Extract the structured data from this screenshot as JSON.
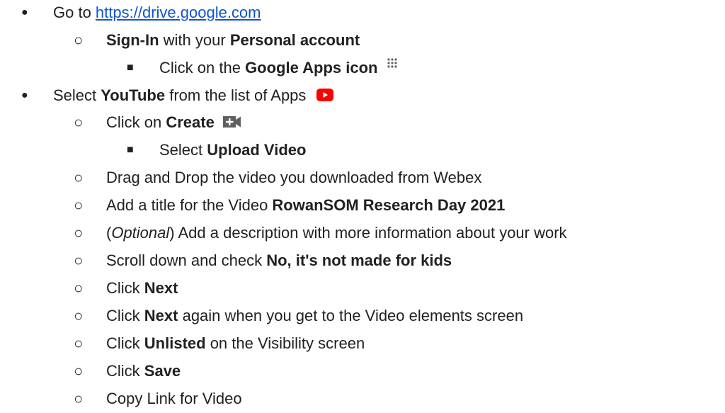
{
  "bullets": {
    "l1": "●",
    "l2": "○",
    "l3": "■"
  },
  "icons": {
    "apps_grid": "google-apps-icon",
    "youtube": "youtube-icon",
    "create": "create-video-icon",
    "youtube_color": "#ff0000"
  },
  "items": [
    {
      "pre": "Go to ",
      "link": "https://drive.google.com"
    },
    {
      "b1": "Sign-In",
      "t1": " with your ",
      "b2": "Personal account"
    },
    {
      "pre": "Click on the ",
      "bold": "Google Apps icon"
    },
    {
      "pre": "Select ",
      "bold": "YouTube",
      "post": " from the list of Apps"
    },
    {
      "pre": "Click on ",
      "bold": "Create"
    },
    {
      "pre": "Select ",
      "bold": "Upload Video"
    },
    {
      "text": "Drag and Drop the video you downloaded from Webex"
    },
    {
      "pre": "Add a title for the Video ",
      "bold": "RowanSOM Research Day 2021"
    },
    {
      "open": "(",
      "italic": "Optional",
      "post": ") Add a description with more information about your work"
    },
    {
      "pre": "Scroll down and check ",
      "bold": "No, it's not made for kids"
    },
    {
      "pre": "Click ",
      "bold": "Next"
    },
    {
      "pre": "Click ",
      "bold": "Next",
      "post": " again when you get to the Video elements screen"
    },
    {
      "pre": "Click ",
      "bold": "Unlisted",
      "post": " on the Visibility screen"
    },
    {
      "pre": "Click ",
      "bold": "Save"
    },
    {
      "text": "Copy Link for Video"
    }
  ]
}
